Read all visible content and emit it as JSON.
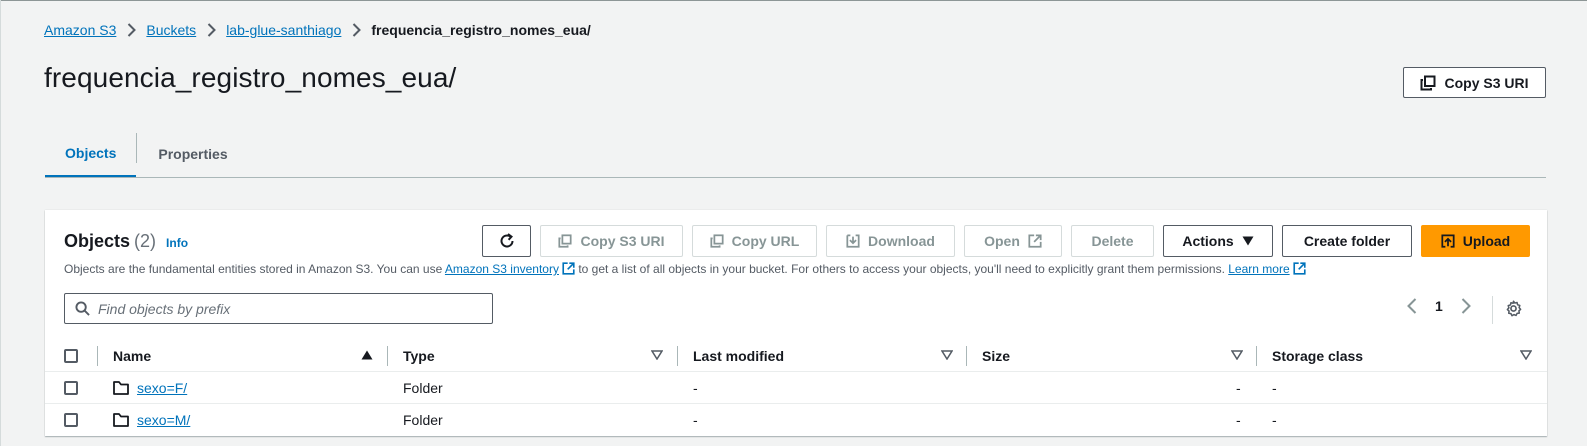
{
  "breadcrumb": {
    "items": [
      "Amazon S3",
      "Buckets",
      "lab-glue-santhiago"
    ],
    "current": "frequencia_registro_nomes_eua/"
  },
  "page_title": "frequencia_registro_nomes_eua/",
  "header": {
    "copy_s3_uri_label": "Copy S3 URI"
  },
  "tabs": [
    {
      "label": "Objects",
      "active": true
    },
    {
      "label": "Properties",
      "active": false
    }
  ],
  "objects_panel": {
    "title": "Objects",
    "count": "(2)",
    "info_label": "Info",
    "description_part1": "Objects are the fundamental entities stored in Amazon S3. You can use ",
    "inventory_link": "Amazon S3 inventory",
    "description_part2": " to get a list of all objects in your bucket. For others to access your objects, you'll need to explicitly grant them permissions. ",
    "learn_more_link": "Learn more",
    "toolbar": {
      "copy_s3_uri": "Copy S3 URI",
      "copy_url": "Copy URL",
      "download": "Download",
      "open": "Open",
      "delete": "Delete",
      "actions": "Actions",
      "create_folder": "Create folder",
      "upload": "Upload"
    },
    "search_placeholder": "Find objects by prefix",
    "pagination": {
      "current_page": "1"
    },
    "columns": [
      "Name",
      "Type",
      "Last modified",
      "Size",
      "Storage class"
    ],
    "rows": [
      {
        "name": "sexo=F/",
        "type": "Folder",
        "last_modified": "-",
        "size": "-",
        "storage_class": "-"
      },
      {
        "name": "sexo=M/",
        "type": "Folder",
        "last_modified": "-",
        "size": "-",
        "storage_class": "-"
      }
    ]
  },
  "colors": {
    "link": "#0073bb",
    "primary": "#ff9900",
    "text": "#16191f",
    "disabled": "#879596"
  }
}
